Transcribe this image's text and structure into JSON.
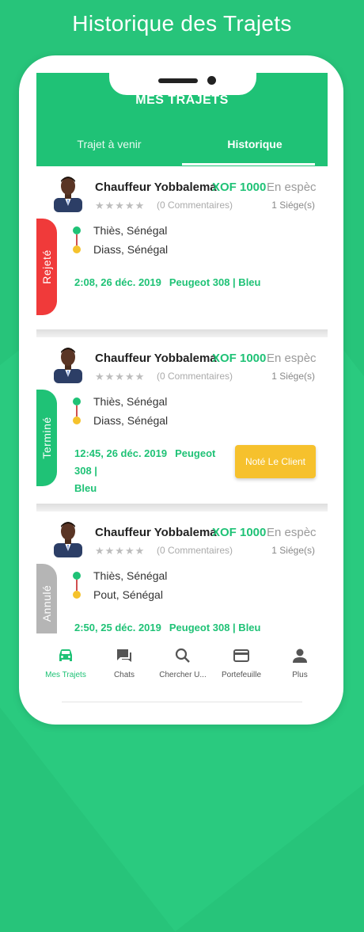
{
  "headline": "Historique des Trajets",
  "header": {
    "title": "MES TRAJETS"
  },
  "tabs": [
    {
      "label": "Trajet à venir"
    },
    {
      "label": "Historique"
    }
  ],
  "trips": [
    {
      "driver": "Chauffeur Yobbalema",
      "price": "XOF 1000",
      "payment": "En espèc",
      "stars": "★★★★★",
      "comments": "(0 Commentaires)",
      "seats": "1 Siége(s)",
      "status": "Rejeté",
      "status_color": "#f03a3a",
      "from": "Thiès, Sénégal",
      "to": "Diass, Sénégal",
      "datetime": "2:08, 26 déc. 2019",
      "vehicle": "Peugeot 308 | Bleu"
    },
    {
      "driver": "Chauffeur Yobbalema",
      "price": "XOF 1000",
      "payment": "En espèc",
      "stars": "★★★★★",
      "comments": "(0 Commentaires)",
      "seats": "1 Siége(s)",
      "status": "Terminé",
      "status_color": "#1fc276",
      "from": "Thiès, Sénégal",
      "to": "Diass, Sénégal",
      "datetime": "12:45, 26 déc. 2019",
      "vehicle": "Peugeot 308 |",
      "vehicle_color": "Bleu",
      "action_label": "Noté Le Client"
    },
    {
      "driver": "Chauffeur Yobbalema",
      "price": "XOF 1000",
      "payment": "En espèc",
      "stars": "★★★★★",
      "comments": "(0 Commentaires)",
      "seats": "1 Siége(s)",
      "status": "Annulé",
      "status_color": "#b5b5b5",
      "from": "Thiès, Sénégal",
      "to": "Pout, Sénégal",
      "datetime": "2:50, 25 déc. 2019",
      "vehicle": "Peugeot 308 | Bleu"
    }
  ],
  "nav": [
    {
      "label": "Mes Trajets",
      "icon": "car-icon"
    },
    {
      "label": "Chats",
      "icon": "chat-icon"
    },
    {
      "label": "Chercher U...",
      "icon": "search-icon"
    },
    {
      "label": "Portefeuille",
      "icon": "wallet-icon"
    },
    {
      "label": "Plus",
      "icon": "person-icon"
    }
  ],
  "colors": {
    "accent": "#1fc276",
    "background": "#27c47a",
    "button": "#f6c12d"
  }
}
